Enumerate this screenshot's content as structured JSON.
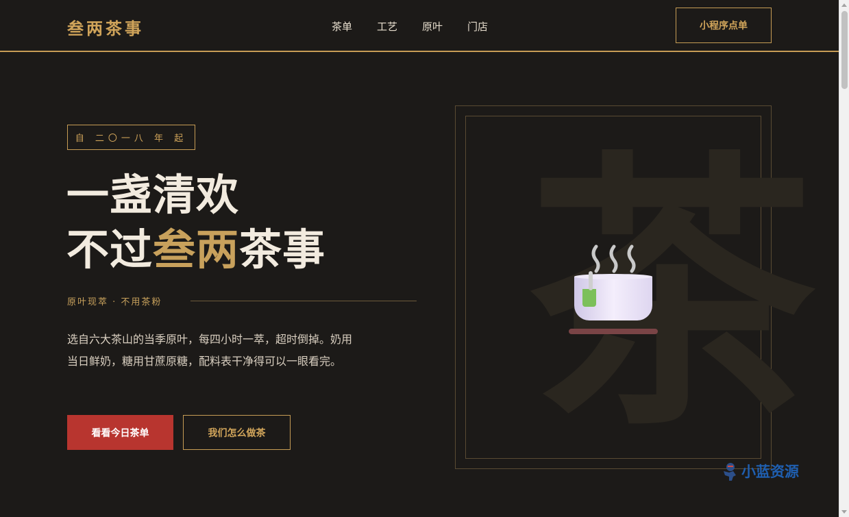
{
  "header": {
    "logo": "叁两茶事",
    "nav": [
      "茶单",
      "工艺",
      "原叶",
      "门店"
    ],
    "order_button": "小程序点单"
  },
  "hero": {
    "since": "自 二〇一八 年 起",
    "title_line1": "一盏清欢",
    "title_line2_prefix": "不过",
    "title_line2_highlight": "叁两",
    "title_line2_suffix": "茶事",
    "tagline": "原叶现萃 · 不用茶粉",
    "description": "选自六大茶山的当季原叶，每四小时一萃，超时倒掉。奶用当日鲜奶，糖用甘蔗原糖，配料表干净得可以一眼看完。",
    "primary_button": "看看今日茶单",
    "secondary_button": "我们怎么做茶"
  },
  "visual": {
    "background_char": "茶",
    "icon": "teacup-icon"
  },
  "watermark": {
    "text": "小蓝资源"
  },
  "colors": {
    "background": "#1c1a18",
    "gold": "#c8a15c",
    "red": "#b8352f",
    "text": "#f2ebdf"
  }
}
